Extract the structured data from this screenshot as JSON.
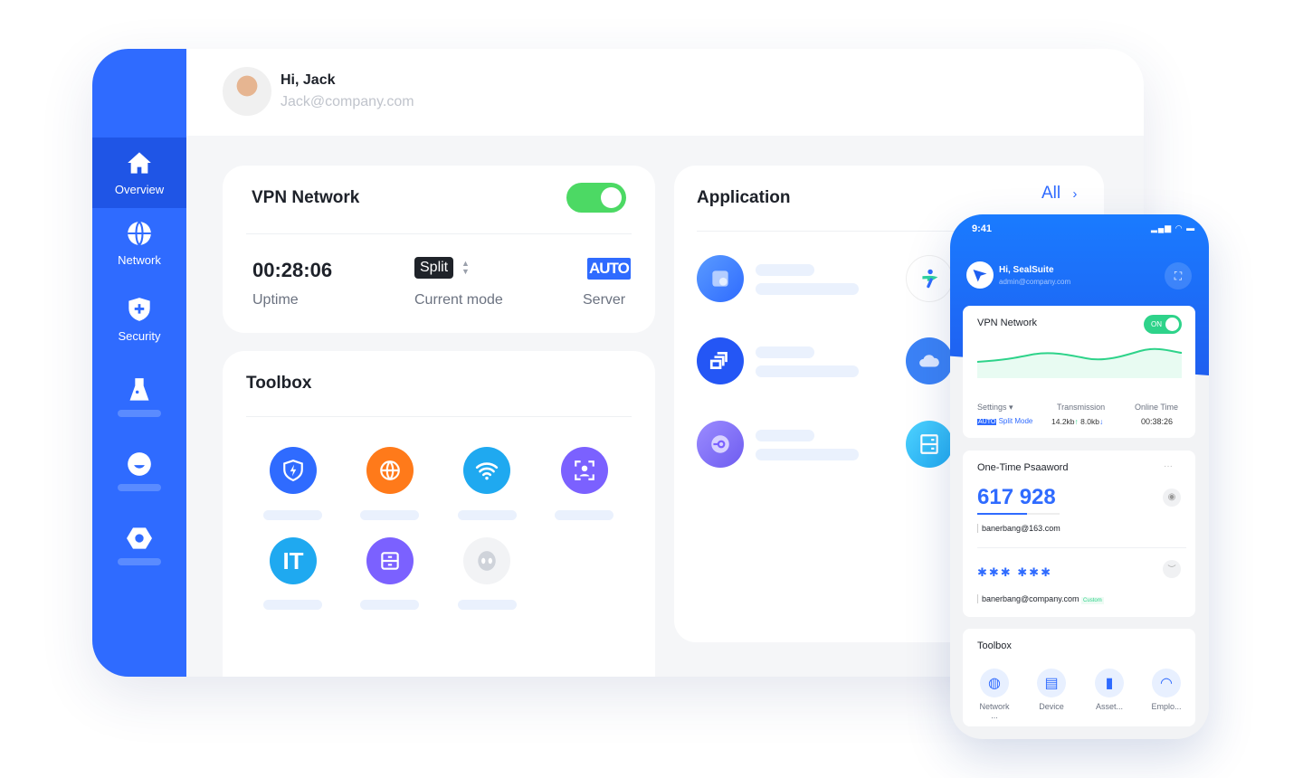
{
  "user": {
    "greeting": "Hi, Jack",
    "email": "Jack@company.com"
  },
  "sidebar": {
    "items": [
      {
        "label": "Overview",
        "icon": "home-icon",
        "active": true
      },
      {
        "label": "Network",
        "icon": "globe-icon"
      },
      {
        "label": "Security",
        "icon": "shield-plus-icon"
      },
      {
        "label": "",
        "icon": "flask-icon"
      },
      {
        "label": "",
        "icon": "face-icon"
      },
      {
        "label": "",
        "icon": "hexagon-icon"
      }
    ]
  },
  "vpn": {
    "title": "VPN Network",
    "enabled": true,
    "uptime": "00:28:06",
    "uptime_label": "Uptime",
    "mode": "Split",
    "mode_label": "Current mode",
    "server": "AUTO",
    "server_label": "Server"
  },
  "toolbox": {
    "title": "Toolbox",
    "icons": [
      "shield-bolt-icon",
      "globe-icon",
      "wifi-icon",
      "face-scan-icon",
      "it-icon",
      "server-icon",
      "alien-icon"
    ]
  },
  "application": {
    "title": "Application",
    "all_label": "All"
  },
  "phone": {
    "time": "9:41",
    "greeting": "Hi, SealSuite",
    "email": "admin@company.com",
    "vpn": {
      "title": "VPN Network",
      "toggle": "ON",
      "settings_label": "Settings",
      "auto": "AUTO",
      "mode": "Split Mode",
      "transmission_label": "Transmission",
      "up": "14.2kb",
      "down": "8.0kb",
      "online_label": "Online Time",
      "online": "00:38:26"
    },
    "otp": {
      "title": "One-Time Psaaword",
      "more": "···",
      "code": "617 928",
      "account1": "banerbang@163.com",
      "masked": "✱✱✱ ✱✱✱",
      "account2": "banerbang@company.com",
      "custom": "Custom",
      "progress": 0.6
    },
    "toolbox": {
      "title": "Toolbox",
      "items": [
        {
          "label": "Network",
          "sub": "..."
        },
        {
          "label": "Device"
        },
        {
          "label": "Asset..."
        },
        {
          "label": "Emplo..."
        }
      ]
    }
  },
  "colors": {
    "primary": "#2f6bff",
    "green": "#34d399",
    "toggle": "#4cd964"
  }
}
